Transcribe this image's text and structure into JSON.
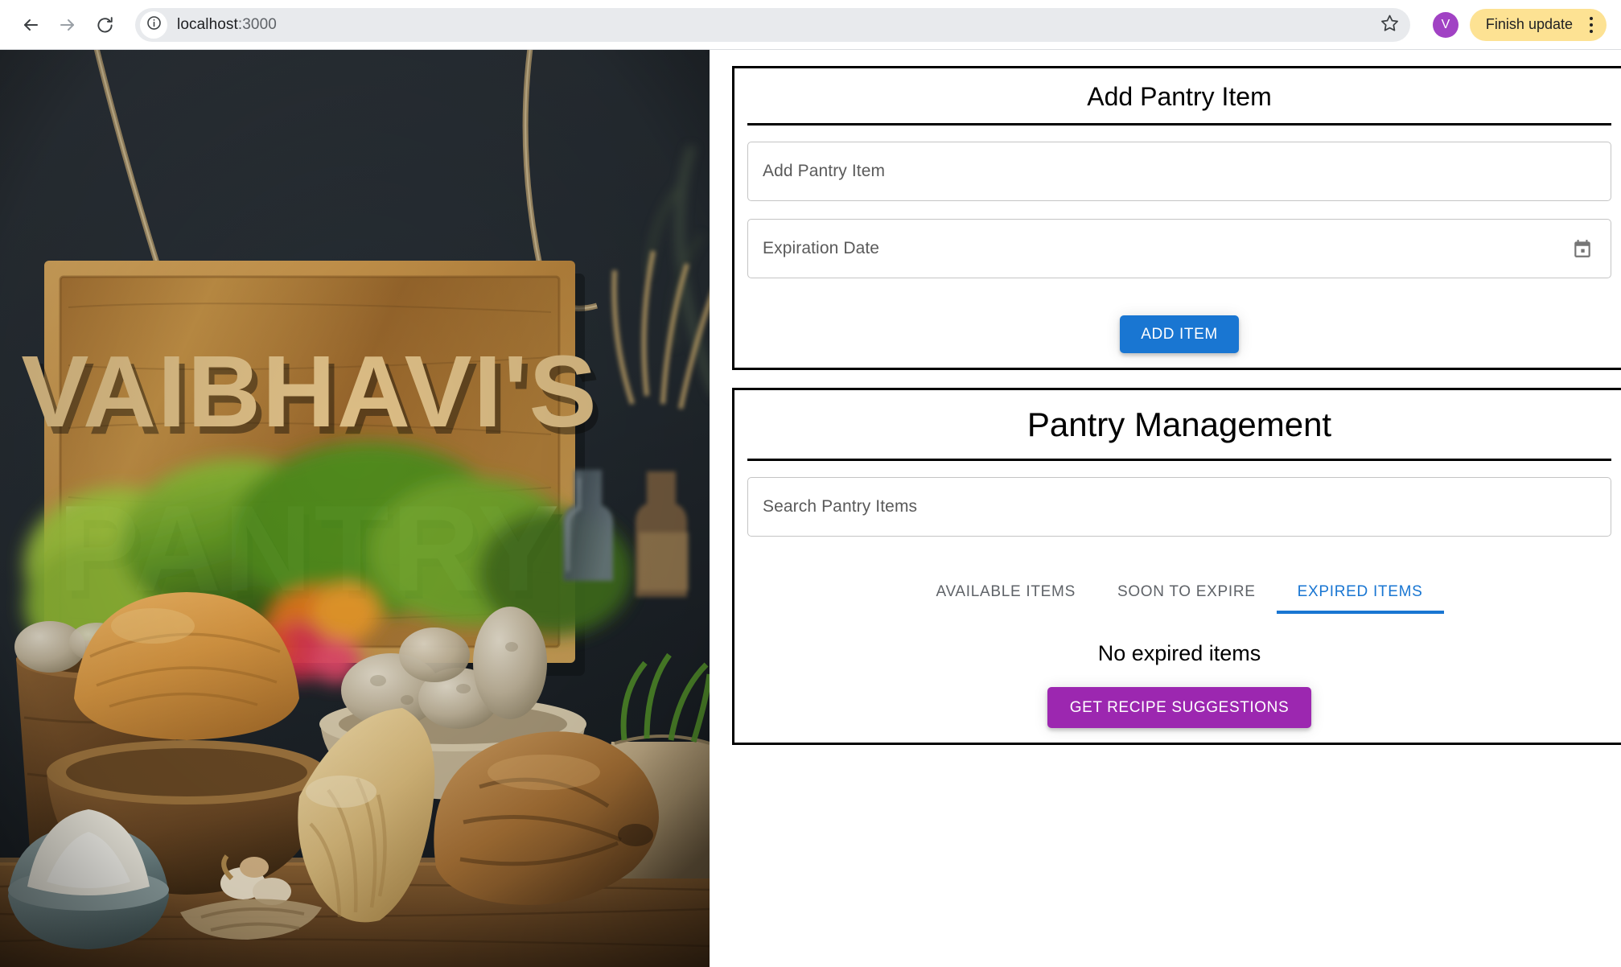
{
  "browser": {
    "back_icon": "back-arrow-icon",
    "forward_icon": "forward-arrow-icon",
    "reload_icon": "reload-icon",
    "site_info_icon": "info-circle-icon",
    "url_host": "localhost",
    "url_suffix": ":3000",
    "url_full": "localhost:3000",
    "bookmark_icon": "star-icon",
    "avatar_initial": "V",
    "avatar_color": "#a142c4",
    "update_label": "Finish update",
    "update_pill_color": "#fde293",
    "menu_icon": "kebab-menu-icon"
  },
  "hero": {
    "sign_line1": "VAIBHAVI'S",
    "sign_line2": "PANTRY",
    "alt": "Wooden hanging sign reading VAIBHAVI'S PANTRY above a rustic table of breads and vegetables"
  },
  "add_card": {
    "title": "Add Pantry Item",
    "item_field": {
      "placeholder": "Add Pantry Item",
      "value": ""
    },
    "date_field": {
      "placeholder": "Expiration Date",
      "value": "",
      "icon": "calendar-icon"
    },
    "submit_label": "ADD ITEM",
    "submit_color": "#1976d2"
  },
  "manage_card": {
    "title": "Pantry Management",
    "search": {
      "placeholder": "Search Pantry Items",
      "value": ""
    },
    "tabs": [
      {
        "label": "AVAILABLE ITEMS",
        "active": false
      },
      {
        "label": "SOON TO EXPIRE",
        "active": false
      },
      {
        "label": "EXPIRED ITEMS",
        "active": true
      }
    ],
    "active_tab_color": "#1976d2",
    "empty_message": "No expired items",
    "recipe_label": "GET RECIPE SUGGESTIONS",
    "recipe_color": "#9c27b0"
  }
}
